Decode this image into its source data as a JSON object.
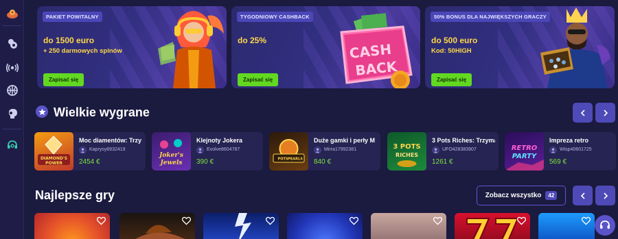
{
  "sidebar": {
    "items": [
      {
        "name": "promo-icon"
      },
      {
        "name": "casino-chips-icon"
      },
      {
        "name": "live-broadcast-icon"
      },
      {
        "name": "sports-ball-icon"
      },
      {
        "name": "boxing-glove-icon"
      },
      {
        "name": "support-headset-icon"
      }
    ]
  },
  "promos": [
    {
      "tag": "PAKIET POWITALNY",
      "line1": "do 1500 euro",
      "line2": "+ 250 darmowych spinów",
      "button": "Zapisać się"
    },
    {
      "tag": "TYGODNIOWY CASHBACK",
      "line1": "do 25%",
      "line2": "",
      "button": "Zapisać się",
      "art_text_1": "CASH",
      "art_text_2": "BACK"
    },
    {
      "tag": "50% BONUS DLA NAJWIĘKSZYCH GRACZY",
      "line1": "do 500 euro",
      "line2": "Kod: 50HIGH",
      "button": "Zapisać się"
    }
  ],
  "big_wins": {
    "title": "Wielkie wygrane",
    "cards": [
      {
        "game": "Moc diamentów: Trzy",
        "user": "Kaprysy8932419",
        "amount": "2454 €",
        "thumb_text_1": "DIAMOND'S",
        "thumb_text_2": "POWER"
      },
      {
        "game": "Klejnoty Jokera",
        "user": "Evolve8604787",
        "amount": "390 €",
        "thumb_text_1": "Joker's",
        "thumb_text_2": "Jewels"
      },
      {
        "game": "Duże gamki i perły M",
        "user": "Mirra17992381",
        "amount": "840 €",
        "thumb_text_1": "POTS",
        "thumb_text_2": "PEARLS"
      },
      {
        "game": "3 Pots Riches: Trzyma",
        "user": "UFO428383907",
        "amount": "1261 €",
        "thumb_text_1": "3 POTS",
        "thumb_text_2": "RICHES"
      },
      {
        "game": "Impreza retro",
        "user": "Wisp40601725",
        "amount": "569 €",
        "thumb_text_1": "RETRO",
        "thumb_text_2": "PARTY"
      }
    ]
  },
  "best_games": {
    "title": "Najlepsze gry",
    "see_all_label": "Zobacz wszystko",
    "count": "42"
  },
  "colors": {
    "background": "#1b1a3f",
    "accent": "#4e4ab7",
    "button_green": "#62d821",
    "promo_yellow": "#ffd84a",
    "amount_green": "#7ee33f"
  }
}
